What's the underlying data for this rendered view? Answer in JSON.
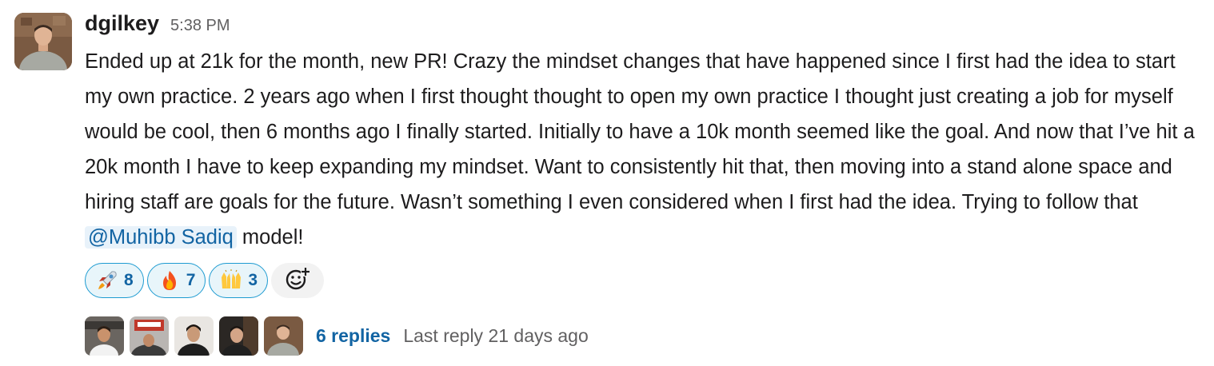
{
  "message": {
    "username": "dgilkey",
    "timestamp": "5:38 PM",
    "text_before_mention": "Ended up at 21k for the month, new PR! Crazy the mindset changes that have happened since I first had the idea to start my own practice. 2 years ago when I first thought thought to open my own practice I thought just creating a job for myself would be cool, then 6 months ago I finally started. Initially to have a 10k month seemed like the goal. And now that I’ve hit a 20k month I have to keep expanding my mindset. Want to consistently hit that, then moving into a stand alone space and hiring staff are goals for the future. Wasn’t something I even considered when I first had the idea. Trying to follow that ",
    "mention": "@Muhibb Sadiq",
    "text_after_mention": " model!"
  },
  "reactions": [
    {
      "emoji": "🚀",
      "emoji_name": "rocket-icon",
      "count": "8"
    },
    {
      "emoji": "🔥",
      "emoji_name": "fire-icon",
      "count": "7"
    },
    {
      "emoji": "🙌",
      "emoji_name": "raised-hands-icon",
      "count": "3"
    }
  ],
  "add_reaction_icon": "add-reaction-icon",
  "thread": {
    "replies": "6 replies",
    "last_reply": "Last reply 21 days ago"
  },
  "colors": {
    "link": "#1264a3",
    "reaction_border": "#1d9bd1",
    "reaction_bg": "#e8f5fa",
    "muted": "#616061"
  }
}
